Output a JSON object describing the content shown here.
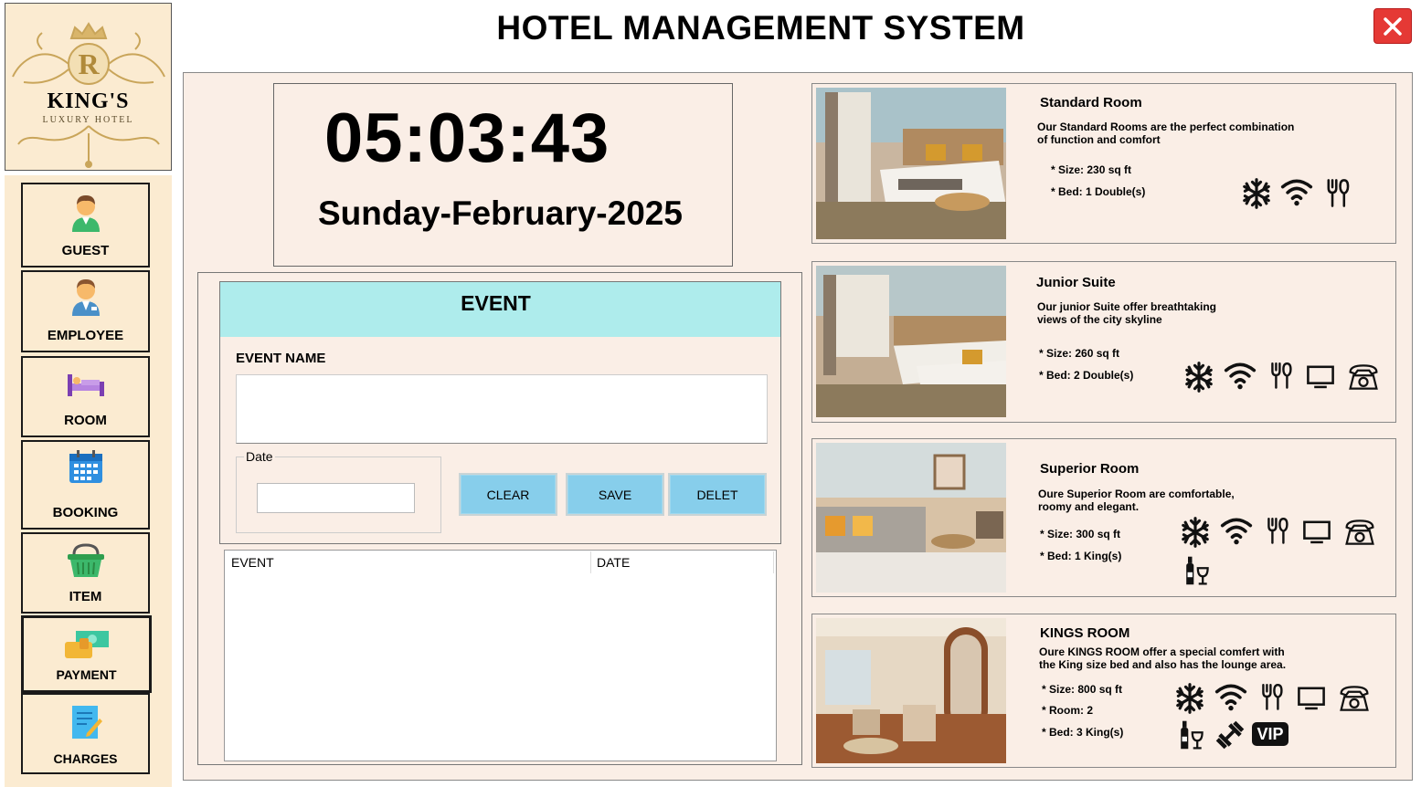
{
  "app": {
    "title": "HOTEL MANAGEMENT SYSTEM",
    "logo_letter": "R",
    "logo_brand": "KING'S",
    "logo_sub": "LUXURY HOTEL"
  },
  "sidebar": {
    "items": [
      {
        "label": "GUEST",
        "icon": "guest-icon"
      },
      {
        "label": "EMPLOYEE",
        "icon": "employee-icon"
      },
      {
        "label": "ROOM",
        "icon": "bed-icon"
      },
      {
        "label": "BOOKING",
        "icon": "calendar-icon"
      },
      {
        "label": "ITEM",
        "icon": "basket-icon"
      },
      {
        "label": "PAYMENT",
        "icon": "payment-icon"
      },
      {
        "label": "CHARGES",
        "icon": "charges-icon"
      }
    ]
  },
  "clock": {
    "time": "05:03:43",
    "date": "Sunday-February-2025"
  },
  "event": {
    "title": "EVENT",
    "name_label": "EVENT NAME",
    "name_value": "",
    "date_label": "Date",
    "date_value": "",
    "buttons": {
      "clear": "CLEAR",
      "save": "SAVE",
      "delete": "DELET"
    },
    "table": {
      "columns": [
        "EVENT",
        "DATE"
      ],
      "rows": []
    }
  },
  "rooms": [
    {
      "name": "Standard Room",
      "desc_line1": "Our Standard Rooms are the perfect combination",
      "desc_line2": "of function and comfort",
      "specs": [
        "* Size: 230 sq ft",
        "* Bed: 1 Double(s)"
      ],
      "amenities": [
        "ac-icon",
        "wifi-icon",
        "dining-icon"
      ]
    },
    {
      "name": "Junior Suite",
      "desc_line1": "Our junior Suite offer breathtaking",
      "desc_line2": "views of the city skyline",
      "specs": [
        "* Size: 260 sq ft",
        "* Bed: 2 Double(s)"
      ],
      "amenities": [
        "ac-icon",
        "wifi-icon",
        "dining-icon",
        "tv-icon",
        "telephone-icon"
      ]
    },
    {
      "name": "Superior Room",
      "desc_line1": "Oure Superior Room are comfortable,",
      "desc_line2": "roomy and elegant.",
      "specs": [
        "* Size: 300 sq ft",
        "* Bed: 1 King(s)"
      ],
      "amenities": [
        "ac-icon",
        "wifi-icon",
        "dining-icon",
        "tv-icon",
        "telephone-icon",
        "minibar-icon"
      ]
    },
    {
      "name": "KINGS ROOM",
      "desc_line1": "Oure KINGS ROOM offer a special comfert with",
      "desc_line2": "the King size bed and also has the lounge area.",
      "specs": [
        "* Size: 800 sq ft",
        "* Room: 2",
        "* Bed: 3 King(s)"
      ],
      "amenities": [
        "ac-icon",
        "wifi-icon",
        "dining-icon",
        "tv-icon",
        "telephone-icon",
        "minibar-icon",
        "gym-icon",
        "vip-icon"
      ],
      "vip_label": "VIP"
    }
  ],
  "colors": {
    "sidebar_bg": "#fbebd1",
    "panel_bg": "#faeee6",
    "event_header": "#aeecec",
    "button_bg": "#87ceeb",
    "close_red": "#e53935"
  }
}
